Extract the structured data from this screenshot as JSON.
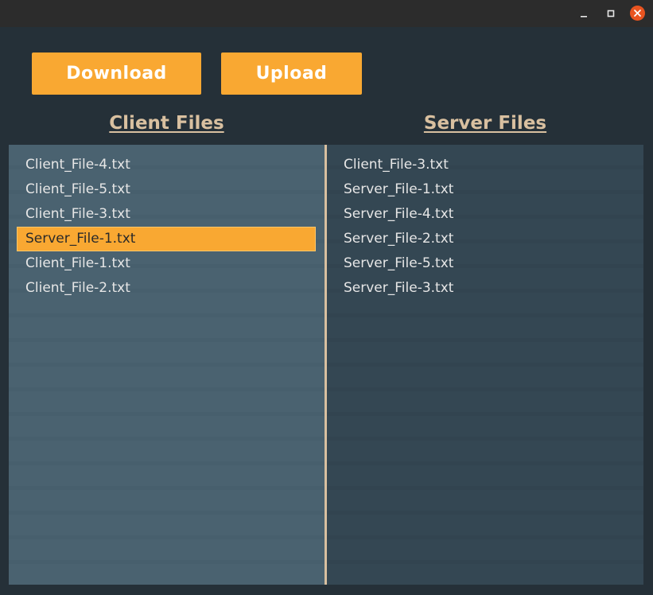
{
  "window": {
    "controls": [
      "minimize-icon",
      "maximize-icon",
      "close-icon"
    ],
    "accent_color": "#e95420"
  },
  "toolbar": {
    "download_label": "Download",
    "upload_label": "Upload",
    "button_color": "#f9a832"
  },
  "client": {
    "heading": "Client Files",
    "files": [
      {
        "name": "Client_File-4.txt",
        "selected": false
      },
      {
        "name": "Client_File-5.txt",
        "selected": false
      },
      {
        "name": "Client_File-3.txt",
        "selected": false
      },
      {
        "name": "Server_File-1.txt",
        "selected": true
      },
      {
        "name": "Client_File-1.txt",
        "selected": false
      },
      {
        "name": "Client_File-2.txt",
        "selected": false
      }
    ]
  },
  "server": {
    "heading": "Server Files",
    "files": [
      {
        "name": "Client_File-3.txt",
        "selected": false
      },
      {
        "name": "Server_File-1.txt",
        "selected": false
      },
      {
        "name": "Server_File-4.txt",
        "selected": false
      },
      {
        "name": "Server_File-2.txt",
        "selected": false
      },
      {
        "name": "Server_File-5.txt",
        "selected": false
      },
      {
        "name": "Server_File-3.txt",
        "selected": false
      }
    ]
  },
  "colors": {
    "heading": "#d9c0a0",
    "selection": "#f9a832",
    "client_panel": "#4a6270",
    "server_panel": "#344753"
  }
}
